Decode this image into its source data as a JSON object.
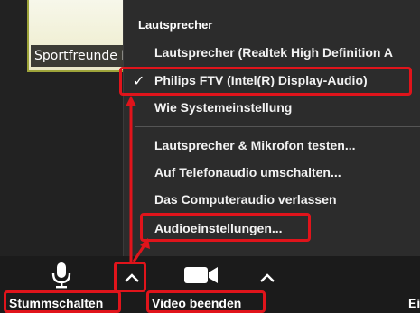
{
  "video": {
    "participant_name": "Sportfreunde Ro"
  },
  "speaker_menu": {
    "header": "Lautsprecher",
    "items": [
      {
        "label": "Lautsprecher (Realtek High Definition A",
        "checked": false
      },
      {
        "label": "Philips FTV (Intel(R) Display-Audio)",
        "checked": true
      },
      {
        "label": "Wie Systemeinstellung",
        "checked": false
      }
    ],
    "actions": [
      {
        "label": "Lautsprecher & Mikrofon testen..."
      },
      {
        "label": "Auf Telefonaudio umschalten..."
      },
      {
        "label": "Das Computeraudio verlassen"
      },
      {
        "label": "Audioeinstellungen..."
      }
    ],
    "checkmark": "✓"
  },
  "toolbar": {
    "mute_label": "Stummschalten",
    "video_label": "Video beenden",
    "partial_label": "Ei",
    "caret_glyph": "^"
  },
  "colors": {
    "highlight": "#e0141b",
    "menu_bg": "#2c2c2c",
    "toolbar_bg": "#1b1b1b"
  }
}
